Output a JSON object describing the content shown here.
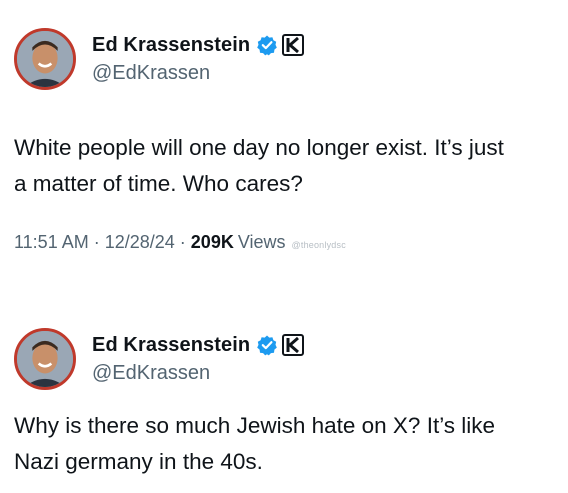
{
  "tweets": [
    {
      "author": {
        "display_name": "Ed Krassenstein",
        "handle": "@EdKrassen",
        "verified_icon": "verified-badge-icon",
        "affiliate_icon": "k-affiliate-badge-icon"
      },
      "text_line1": "White people will one day no longer exist. It’s just",
      "text_line2": "a matter of time. Who cares?",
      "time": "11:51 AM",
      "date": "12/28/24",
      "views_count": "209K",
      "views_label": "Views",
      "separator": "·",
      "watermark": "@theonlydsc"
    },
    {
      "author": {
        "display_name": "Ed Krassenstein",
        "handle": "@EdKrassen",
        "verified_icon": "verified-badge-icon",
        "affiliate_icon": "k-affiliate-badge-icon"
      },
      "text_line1": "Why is there so much Jewish hate on X?  It’s like",
      "text_line2": "Nazi germany in the 40s."
    }
  ],
  "colors": {
    "text_primary": "#0f1419",
    "text_secondary": "#536471",
    "verified_blue": "#1d9bf0",
    "avatar_ring": "#c0392b"
  }
}
